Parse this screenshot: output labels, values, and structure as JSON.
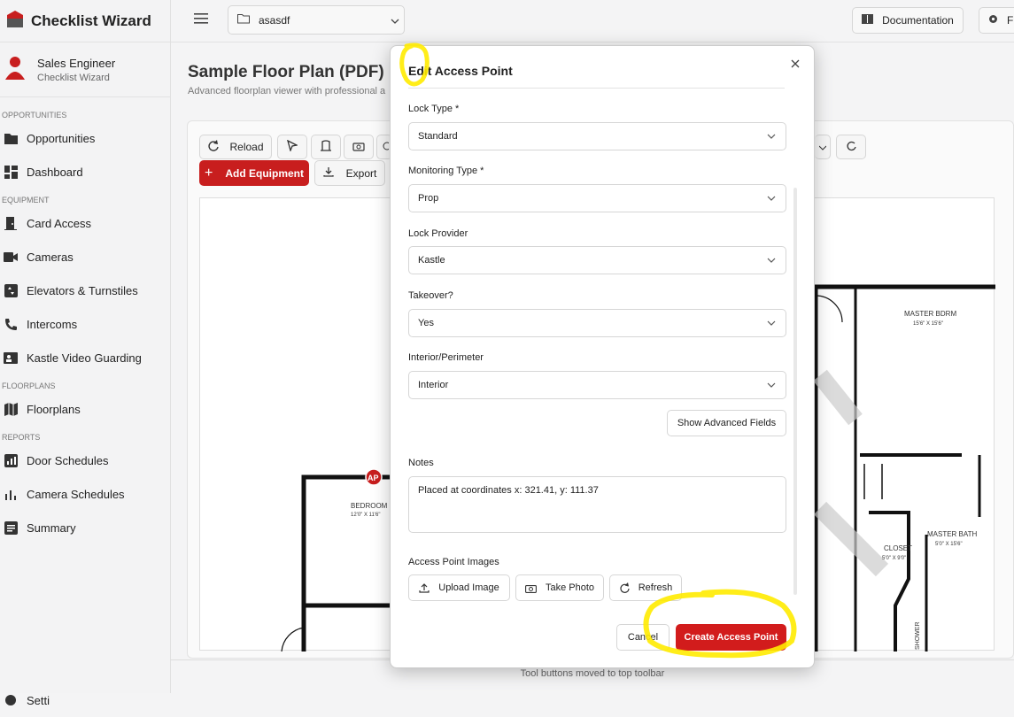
{
  "app": {
    "title": "Checklist Wizard"
  },
  "user": {
    "name": "Sales Engineer",
    "subtitle": "Checklist Wizard"
  },
  "sidebar": {
    "sections": [
      {
        "label": "OPPORTUNITIES",
        "items": [
          {
            "label": "Opportunities",
            "icon": "folder-icon"
          },
          {
            "label": "Dashboard",
            "icon": "dashboard-icon"
          }
        ]
      },
      {
        "label": "EQUIPMENT",
        "items": [
          {
            "label": "Card Access",
            "icon": "door-icon"
          },
          {
            "label": "Cameras",
            "icon": "camera-icon"
          },
          {
            "label": "Elevators & Turnstiles",
            "icon": "elevator-icon"
          },
          {
            "label": "Intercoms",
            "icon": "phone-icon"
          },
          {
            "label": "Kastle Video Guarding",
            "icon": "video-guard-icon"
          }
        ]
      },
      {
        "label": "FLOORPLANS",
        "items": [
          {
            "label": "Floorplans",
            "icon": "map-icon"
          }
        ]
      },
      {
        "label": "REPORTS",
        "items": [
          {
            "label": "Door Schedules",
            "icon": "chart-icon"
          },
          {
            "label": "Camera Schedules",
            "icon": "bar-icon"
          },
          {
            "label": "Summary",
            "icon": "summary-icon"
          }
        ]
      }
    ],
    "partial_bottom": "Setti"
  },
  "topbar": {
    "project": "asasdf",
    "documentation": "Documentation",
    "settings_partial": "F"
  },
  "page": {
    "title": "Sample Floor Plan (PDF)",
    "subtitle": "Advanced floorplan viewer with professional a"
  },
  "toolbar": {
    "reload": "Reload",
    "add_equipment": "Add Equipment",
    "export": "Export"
  },
  "status": "Tool buttons moved to top toolbar",
  "floorplan": {
    "master_bdrm": "MASTER BDRM",
    "master_bdrm_size": "15'6\" X 15'6\"",
    "bedroom": "BEDROOM",
    "bedroom_size": "12'0\" X 11'6\"",
    "closet": "CLOSET",
    "closet_size": "5'0\" X 9'0\"",
    "master_bath": "MASTER BATH",
    "master_bath_size": "5'0\" X 15'6\"",
    "shower": "SHOWER",
    "marker": "AP"
  },
  "modal": {
    "title": "Edit Access Point",
    "fields": {
      "lock_type": {
        "label": "Lock Type *",
        "value": "Standard"
      },
      "monitoring_type": {
        "label": "Monitoring Type *",
        "value": "Prop"
      },
      "lock_provider": {
        "label": "Lock Provider",
        "value": "Kastle"
      },
      "takeover": {
        "label": "Takeover?",
        "value": "Yes"
      },
      "interior_perimeter": {
        "label": "Interior/Perimeter",
        "value": "Interior"
      }
    },
    "advanced": "Show Advanced Fields",
    "notes_label": "Notes",
    "notes_value": "Placed at coordinates x: 321.41, y: 111.37",
    "images_label": "Access Point Images",
    "upload": "Upload Image",
    "take_photo": "Take Photo",
    "refresh": "Refresh",
    "cancel": "Cancel",
    "create": "Create Access Point"
  },
  "colors": {
    "accent": "#d21c1c",
    "highlight": "#ffeb00"
  }
}
